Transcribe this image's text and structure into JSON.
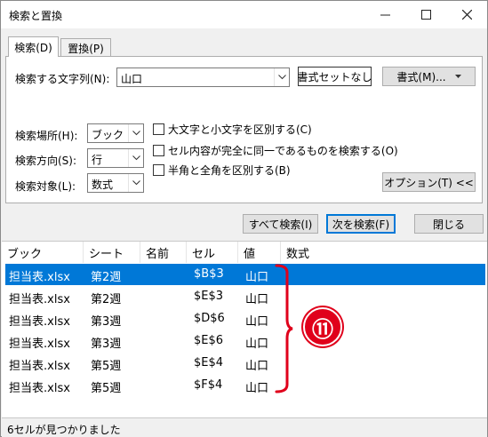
{
  "window": {
    "title": "検索と置換"
  },
  "tabs": [
    {
      "label": "検索(D)"
    },
    {
      "label": "置換(P)"
    }
  ],
  "find": {
    "search_label": "検索する文字列(N):",
    "search_value": "山口",
    "no_format_button": "書式セットなし",
    "format_button": "書式(M)..."
  },
  "options": {
    "within_label": "検索場所(H):",
    "within_value": "ブック",
    "direction_label": "検索方向(S):",
    "direction_value": "行",
    "lookin_label": "検索対象(L):",
    "lookin_value": "数式",
    "match_case": "大文字と小文字を区別する(C)",
    "match_entire": "セル内容が完全に同一であるものを検索する(O)",
    "match_byte": "半角と全角を区別する(B)",
    "options_button": "オプション(T) <<"
  },
  "actions": {
    "find_all": "すべて検索(I)",
    "find_next": "次を検索(F)",
    "close": "閉じる"
  },
  "results": {
    "columns": [
      "ブック",
      "シート",
      "名前",
      "セル",
      "値",
      "数式"
    ],
    "rows": [
      {
        "book": "担当表.xlsx",
        "sheet": "第2週",
        "name": "",
        "cell": "$B$3",
        "value": "山口",
        "formula": ""
      },
      {
        "book": "担当表.xlsx",
        "sheet": "第2週",
        "name": "",
        "cell": "$E$3",
        "value": "山口",
        "formula": ""
      },
      {
        "book": "担当表.xlsx",
        "sheet": "第3週",
        "name": "",
        "cell": "$D$6",
        "value": "山口",
        "formula": ""
      },
      {
        "book": "担当表.xlsx",
        "sheet": "第3週",
        "name": "",
        "cell": "$E$6",
        "value": "山口",
        "formula": ""
      },
      {
        "book": "担当表.xlsx",
        "sheet": "第5週",
        "name": "",
        "cell": "$E$4",
        "value": "山口",
        "formula": ""
      },
      {
        "book": "担当表.xlsx",
        "sheet": "第5週",
        "name": "",
        "cell": "$F$4",
        "value": "山口",
        "formula": ""
      }
    ]
  },
  "status": "6セルが見つかりました",
  "annotation": {
    "badge": "⑪",
    "color": "#e0001b"
  }
}
